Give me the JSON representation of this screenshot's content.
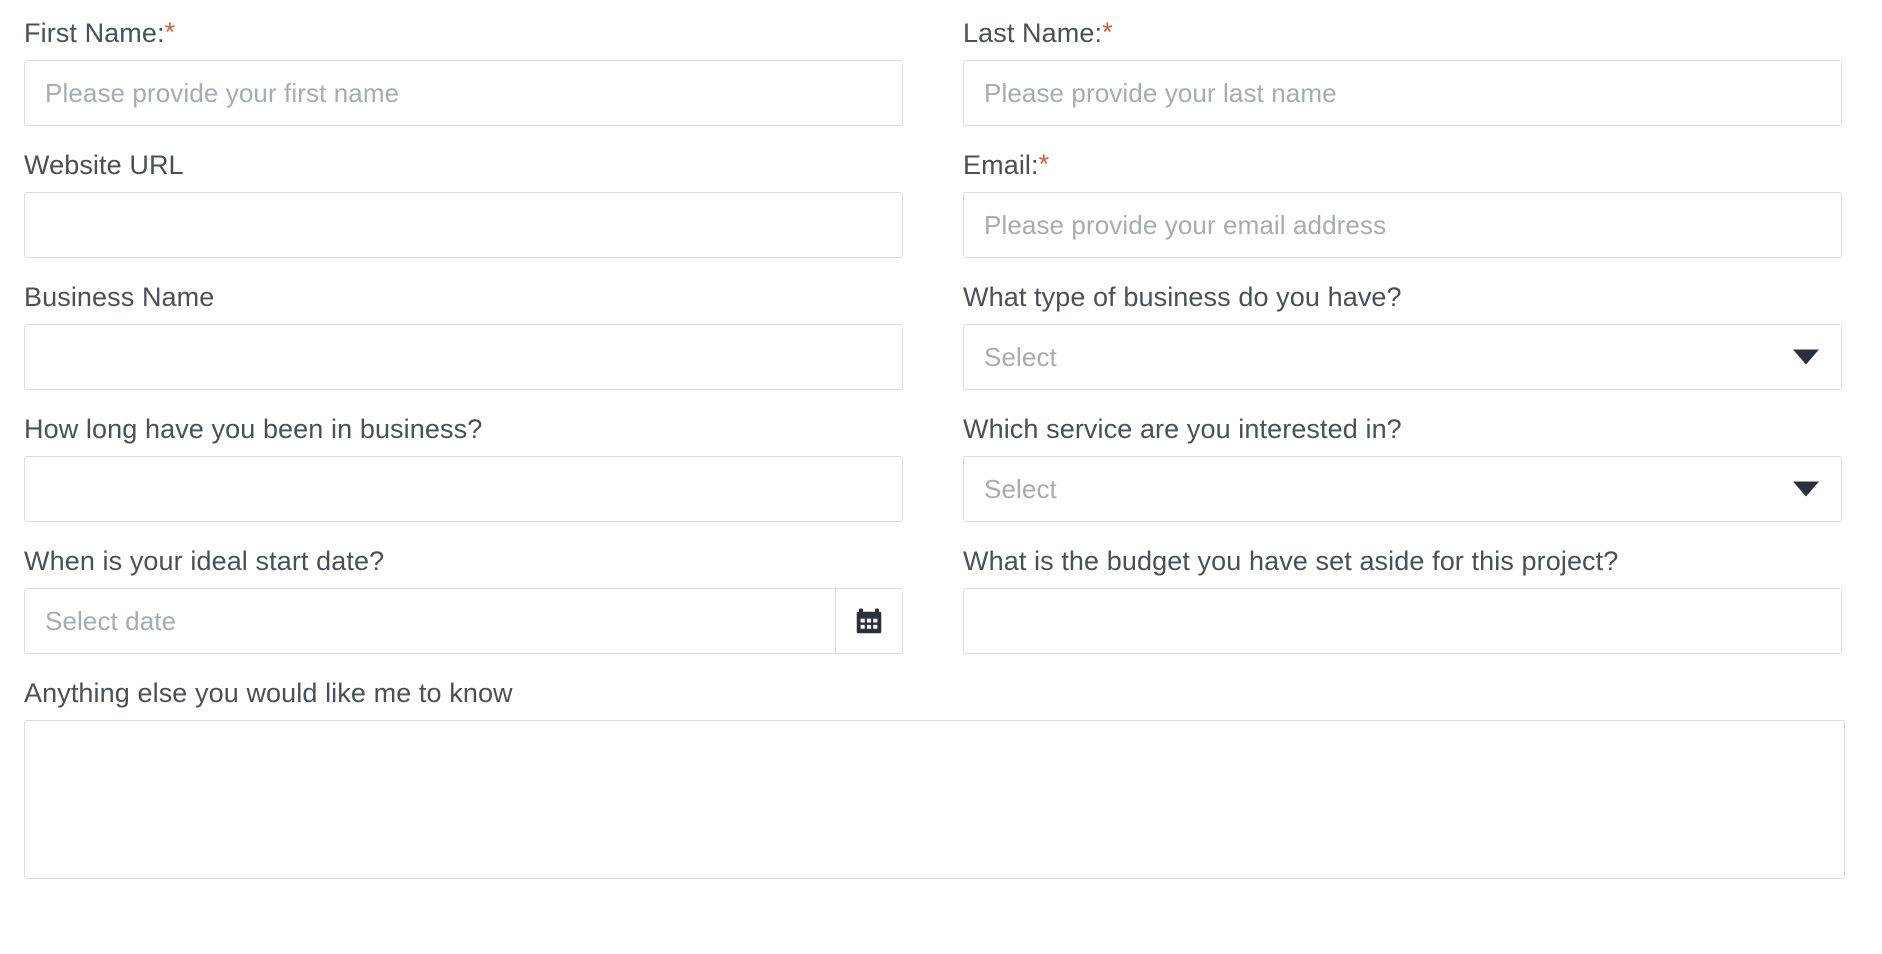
{
  "form": {
    "rows": [
      {
        "left": {
          "label": "First Name:",
          "required": true,
          "placeholder": "Please provide your first name",
          "value": "",
          "type": "text"
        },
        "right": {
          "label": "Last Name:",
          "required": true,
          "placeholder": "Please provide your last name",
          "value": "",
          "type": "text"
        }
      },
      {
        "left": {
          "label": "Website URL",
          "required": false,
          "placeholder": "",
          "value": "",
          "type": "text"
        },
        "right": {
          "label": "Email:",
          "required": true,
          "placeholder": "Please provide your email address",
          "value": "",
          "type": "text"
        }
      },
      {
        "left": {
          "label": "Business Name",
          "required": false,
          "placeholder": "",
          "value": "",
          "type": "text"
        },
        "right": {
          "label": "What type of business do you have?",
          "required": false,
          "placeholder": "Select",
          "value": "",
          "type": "select"
        }
      },
      {
        "left": {
          "label": "How long have you been in business?",
          "required": false,
          "placeholder": "",
          "value": "",
          "type": "text"
        },
        "right": {
          "label": "Which service are you interested in?",
          "required": false,
          "placeholder": "Select",
          "value": "",
          "type": "select"
        }
      },
      {
        "left": {
          "label": "When is your ideal start date?",
          "required": false,
          "placeholder": "Select date",
          "value": "",
          "type": "date"
        },
        "right": {
          "label": "What is the budget you have set aside for this project?",
          "required": false,
          "placeholder": "",
          "value": "",
          "type": "text"
        }
      }
    ],
    "message": {
      "label": "Anything else you would like me to know",
      "required": false,
      "placeholder": "",
      "value": "",
      "type": "textarea"
    },
    "required_marker": "*",
    "icons": {
      "calendar": "calendar-icon",
      "caret": "chevron-down-icon"
    },
    "colors": {
      "label_text": "#4a5058",
      "required_star": "#e05a3c",
      "placeholder_text": "#a7abb3",
      "field_border": "#dcdee3",
      "icon_dark": "#2b303a",
      "background": "#ffffff"
    }
  }
}
